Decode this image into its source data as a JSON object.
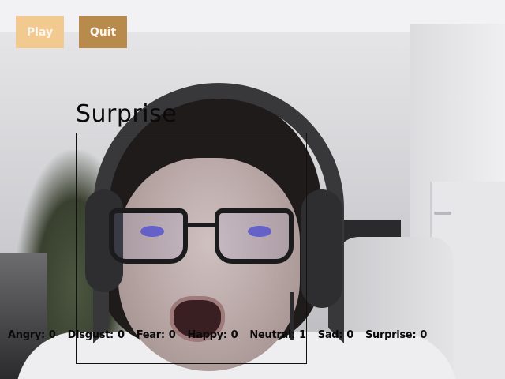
{
  "buttons": {
    "play_label": "Play",
    "quit_label": "Quit",
    "play_color": "#f2c98f",
    "quit_color": "#b88a4c"
  },
  "detection": {
    "emotion_label": "Surprise",
    "box_color": "#111111"
  },
  "emotion_counts": [
    {
      "name": "Angry:",
      "count": "0"
    },
    {
      "name": "Disgust:",
      "count": "0"
    },
    {
      "name": "Fear:",
      "count": "0"
    },
    {
      "name": "Happy:",
      "count": "0"
    },
    {
      "name": "Neutral:",
      "count": "1"
    },
    {
      "name": "Sad:",
      "count": "0"
    },
    {
      "name": "Surprise:",
      "count": "0"
    }
  ]
}
